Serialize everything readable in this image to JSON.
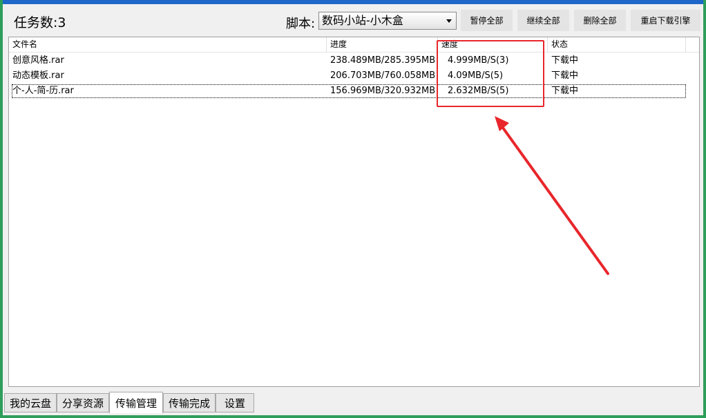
{
  "header": {
    "task_count": "任务数:3",
    "script_label": "脚本:",
    "script_selected": "数码小站-小木盒"
  },
  "toolbar": {
    "pause_all": "暂停全部",
    "resume_all": "继续全部",
    "delete_all": "删除全部",
    "restart_engine": "重启下载引擎"
  },
  "table": {
    "columns": [
      "文件名",
      "进度",
      "速度",
      "状态"
    ],
    "rows": [
      {
        "name": "创意风格.rar",
        "progress": "238.489MB/285.395MB",
        "speed": "4.999MB/S(3)",
        "status": "下载中"
      },
      {
        "name": "动态模板.rar",
        "progress": "206.703MB/760.058MB",
        "speed": "4.09MB/S(5)",
        "status": "下载中"
      },
      {
        "name": "个-人-简-历.rar",
        "progress": "156.969MB/320.932MB",
        "speed": "2.632MB/S(5)",
        "status": "下载中"
      }
    ]
  },
  "tabs": [
    {
      "label": "我的云盘"
    },
    {
      "label": "分享资源"
    },
    {
      "label": "传输管理"
    },
    {
      "label": "传输完成"
    },
    {
      "label": "设置"
    }
  ],
  "colors": {
    "accent_blue": "#1e68c9",
    "frame_green": "#2e9e5b",
    "annotation_red": "#e8262b"
  }
}
